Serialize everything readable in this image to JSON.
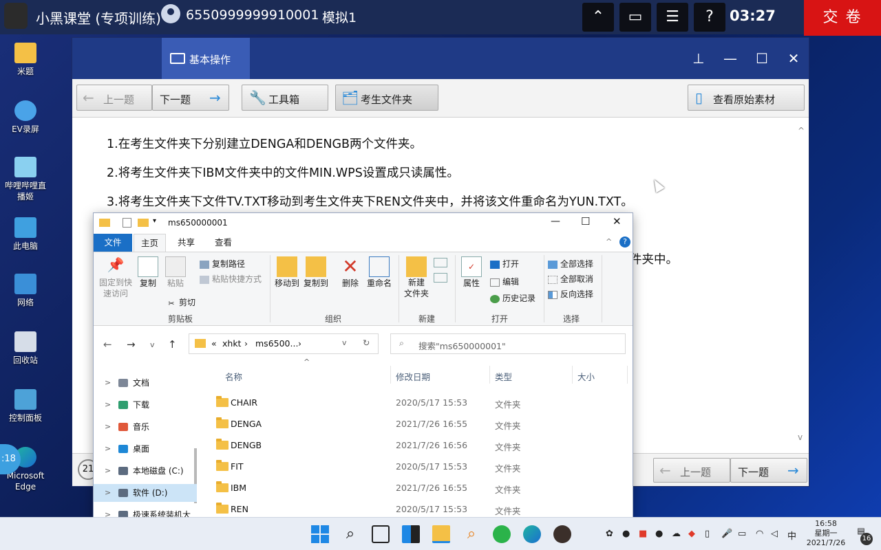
{
  "exam_bar": {
    "title": "小黑课堂 (专项训练)",
    "user_id": "6550999999910001",
    "mode": "模拟1",
    "icons": [
      "collapse-icon",
      "window-icon",
      "checklist-icon",
      "help-icon"
    ],
    "help_glyph": "?",
    "timer": "03:27",
    "submit_label": "交 卷"
  },
  "desktop_icons": [
    {
      "label": "米题",
      "icon": "folder-icon"
    },
    {
      "label": "EV录屏",
      "icon": "ev-recorder-icon"
    },
    {
      "label": "哔哩哔哩直播姬",
      "icon": "bilibili-live-icon"
    },
    {
      "label": "此电脑",
      "icon": "computer-icon"
    },
    {
      "label": "网络",
      "icon": "network-icon"
    },
    {
      "label": "回收站",
      "icon": "recycle-bin-icon"
    },
    {
      "label": "控制面板",
      "icon": "control-panel-icon"
    },
    {
      "label": "Microsoft Edge",
      "icon": "edge-icon"
    }
  ],
  "exam_window": {
    "tab_label": "基本操作",
    "window_controls": [
      "pin-icon",
      "minimize-icon",
      "maximize-icon",
      "close-icon"
    ],
    "toolbar": {
      "prev": "上一题",
      "next": "下一题",
      "toolbox": "工具箱",
      "exam_folder": "考生文件夹",
      "view_source": "查看原始素材"
    },
    "questions": [
      "1.在考生文件夹下分别建立DENGA和DENGB两个文件夹。",
      "2.将考生文件夹下IBM文件夹中的文件MIN.WPS设置成只读属性。",
      "3.将考生文件夹下文件TV.TXT移动到考生文件夹下REN文件夹中，并将该文件重命名为YUN.TXT。"
    ],
    "partial_text": "件夹中。",
    "footer": {
      "prev": "上一题",
      "next": "下一题",
      "left_partial": "21"
    }
  },
  "explorer": {
    "title": "ms650000001",
    "tabs": [
      "文件",
      "主页",
      "共享",
      "查看"
    ],
    "active_tab": "主页",
    "ribbon": {
      "clipboard": {
        "group": "剪贴板",
        "pin": "固定到快\n速访问",
        "copy": "复制",
        "paste": "粘贴",
        "copy_path": "复制路径",
        "paste_shortcut": "粘贴快捷方式",
        "cut": "剪切"
      },
      "organize": {
        "group": "组织",
        "move_to": "移动到",
        "copy_to": "复制到",
        "delete": "删除",
        "rename": "重命名"
      },
      "new": {
        "group": "新建",
        "new_folder": "新建\n文件夹"
      },
      "open": {
        "group": "打开",
        "properties": "属性",
        "open": "打开",
        "edit": "编辑",
        "history": "历史记录"
      },
      "select": {
        "group": "选择",
        "select_all": "全部选择",
        "select_none": "全部取消",
        "invert": "反向选择"
      }
    },
    "address": {
      "prefix": "«",
      "part1": "xhkt",
      "part2": "ms6500...",
      "sep": "›"
    },
    "search_placeholder": "搜索\"ms650000001\"",
    "nav_items": [
      {
        "label": "文档",
        "color": "#7d8797"
      },
      {
        "label": "下载",
        "color": "#2f9e6f"
      },
      {
        "label": "音乐",
        "color": "#e0583a"
      },
      {
        "label": "桌面",
        "color": "#1e88d6"
      },
      {
        "label": "本地磁盘 (C:)",
        "color": "#5c6b7f"
      },
      {
        "label": "软件 (D:)",
        "color": "#5c6b7f",
        "selected": true
      },
      {
        "label": "极速系统装机大",
        "color": "#5c6b7f"
      }
    ],
    "columns": {
      "name": "名称",
      "date": "修改日期",
      "type": "类型",
      "size": "大小"
    },
    "files": [
      {
        "name": "CHAIR",
        "date": "2020/5/17 15:53",
        "type": "文件夹"
      },
      {
        "name": "DENGA",
        "date": "2021/7/26 16:55",
        "type": "文件夹"
      },
      {
        "name": "DENGB",
        "date": "2021/7/26 16:56",
        "type": "文件夹"
      },
      {
        "name": "FIT",
        "date": "2020/5/17 15:53",
        "type": "文件夹"
      },
      {
        "name": "IBM",
        "date": "2021/7/26 16:55",
        "type": "文件夹"
      },
      {
        "name": "REN",
        "date": "2020/5/17 15:53",
        "type": "文件夹"
      }
    ]
  },
  "taskbar": {
    "ime": "中",
    "time": "16:58",
    "weekday": "星期一",
    "date": "2021/7/26",
    "notifications": "16",
    "left_partial": ":18"
  }
}
